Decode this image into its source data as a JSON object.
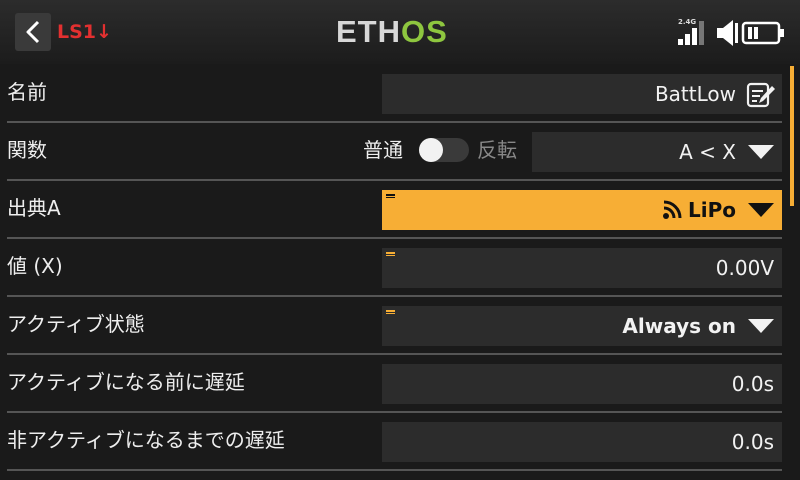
{
  "header": {
    "title": "LS1↓",
    "logo_main": "ETH",
    "logo_accent": "OS",
    "band": "2.4G",
    "accent_color": "#f7ae35",
    "title_color": "#e23030",
    "logo_accent_color": "#8ec63f",
    "icons": [
      "back-arrow-icon",
      "signal-strength-icon",
      "speaker-icon",
      "battery-icon"
    ]
  },
  "rows": {
    "name": {
      "label": "名前",
      "value": "BattLow"
    },
    "function": {
      "label": "関数",
      "normal_label": "普通",
      "invert_label": "反転",
      "inverted": false,
      "value": "A < X"
    },
    "source_a": {
      "label": "出典A",
      "value": "LiPo"
    },
    "value_x": {
      "label": "値 (X)",
      "value": "0.00V"
    },
    "active_state": {
      "label": "アクティブ状態",
      "value": "Always on"
    },
    "delay_active": {
      "label": "アクティブになる前に遅延",
      "value": "0.0s"
    },
    "delay_inactive": {
      "label": "非アクティブになるまでの遅延",
      "value": "0.0s"
    }
  }
}
